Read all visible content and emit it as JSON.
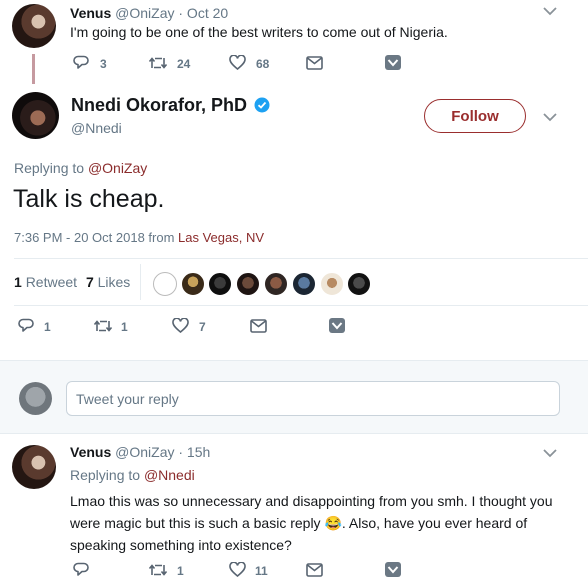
{
  "colors": {
    "accent": "#8b2c2c",
    "muted": "#657786",
    "verified": "#1da1f2"
  },
  "parent_tweet": {
    "name": "Venus",
    "handle": "@OniZay",
    "time": "· Oct 20",
    "text": "I'm going to be one of the best writers to come out of Nigeria.",
    "reply_count": "3",
    "retweet_count": "24",
    "like_count": "68"
  },
  "main_tweet": {
    "name": "Nnedi Okorafor, PhD",
    "handle": "@Nnedi",
    "follow_label": "Follow",
    "replying_prefix": "Replying to",
    "replying_handle": "@OniZay",
    "text": "Talk is cheap.",
    "timestamp": "7:36 PM - 20 Oct 2018 from",
    "location": "Las Vegas, NV",
    "retweets_num": "1",
    "retweets_label": "Retweet",
    "likes_num": "7",
    "likes_label": "Likes",
    "reply_count": "1",
    "retweet_count": "1",
    "like_count": "7"
  },
  "reply_composer": {
    "placeholder": "Tweet your reply"
  },
  "reply_tweet": {
    "name": "Venus",
    "handle": "@OniZay",
    "time": "· 15h",
    "replying_prefix": "Replying to",
    "replying_handle": "@Nnedi",
    "text_line1": "Lmao this was so unnecessary and disappointing from you smh. I thought you",
    "text_line2a": "were magic but this is such a basic reply",
    "emoji": "😂",
    "text_line2b": ". Also, have you ever heard of",
    "text_line3": "speaking something into existence?",
    "reply_count": "",
    "retweet_count": "1",
    "like_count": "11"
  }
}
